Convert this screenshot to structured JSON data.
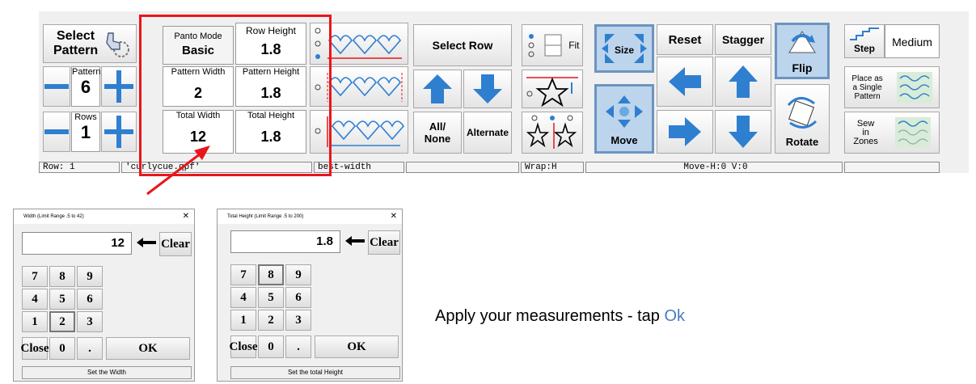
{
  "toolbar": {
    "select_pattern": "Select\nPattern",
    "patterns_label": "Patterns",
    "patterns_value": "6",
    "rows_label": "Rows",
    "rows_value": "1",
    "panto_mode_label": "Panto Mode",
    "panto_mode_value": "Basic",
    "row_height_label": "Row Height",
    "row_height_value": "1.8",
    "pattern_width_label": "Pattern Width",
    "pattern_width_value": "2",
    "pattern_height_label": "Pattern Height",
    "pattern_height_value": "1.8",
    "total_width_label": "Total Width",
    "total_width_value": "12",
    "total_height_label": "Total Height",
    "total_height_value": "1.8",
    "select_row": "Select Row",
    "all_none": "All/\nNone",
    "alternate": "Alternate",
    "fit": "Fit",
    "size": "Size",
    "reset": "Reset",
    "stagger": "Stagger",
    "flip": "Flip",
    "move": "Move",
    "rotate": "Rotate",
    "step": "Step",
    "medium": "Medium",
    "place_single": "Place as\na Single\nPattern",
    "sew_zones": "Sew\nin\nZones"
  },
  "statusbar": {
    "row": "Row: 1",
    "file": "'curlycue.qpf'",
    "mode": "best-width",
    "empty1": "",
    "wrap": "Wrap:H",
    "move": "Move-H:0 V:0",
    "empty2": ""
  },
  "width_dialog": {
    "title": "Width  (Limit Range .5 to 42)",
    "value": "12",
    "clear": "Clear",
    "keys": [
      "7",
      "8",
      "9",
      "4",
      "5",
      "6",
      "1",
      "2",
      "3",
      "Close",
      "0",
      ".",
      "OK"
    ],
    "hint": "Set the Width"
  },
  "height_dialog": {
    "title": "Total Height  (Limit Range .5 to 200)",
    "value": "1.8",
    "clear": "Clear",
    "keys": [
      "7",
      "8",
      "9",
      "4",
      "5",
      "6",
      "1",
      "2",
      "3",
      "Close",
      "0",
      ".",
      "OK"
    ],
    "hint": "Set the total Height"
  },
  "caption": {
    "text": "Apply your measurements - tap ",
    "link": "Ok"
  },
  "colors": {
    "highlight": "#e8161c",
    "accent_blue": "#2f7fd0",
    "link": "#4a7ab8"
  }
}
